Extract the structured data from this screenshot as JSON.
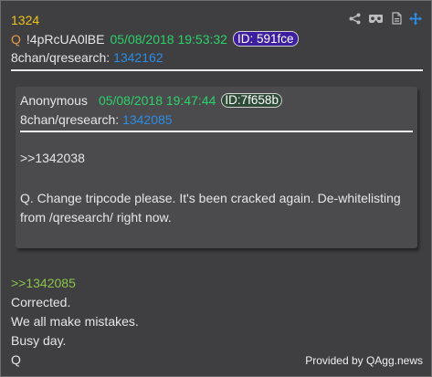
{
  "post": {
    "number": "1324",
    "q_letter": "Q",
    "tripcode": "!4pRcUA0lBE",
    "date": "05/08/2018 19:53:32",
    "id_badge": "ID: 591fce",
    "board_prefix": "8chan/qresearch:",
    "board_post": "1342162"
  },
  "toolbar": {
    "icons": [
      "share-icon",
      "vr-glasses-icon",
      "document-icon",
      "move-arrows-icon"
    ]
  },
  "quoted": {
    "name": "Anonymous",
    "date": "05/08/2018 19:47:44",
    "id_badge": "ID:7f658b",
    "board_prefix": "8chan/qresearch:",
    "board_post": "1342085",
    "ref": ">>1342038",
    "body": "Q. Change tripcode please. It's been cracked again. De-whitelisting from /qresearch/ right now."
  },
  "reply": {
    "ref": ">>1342085",
    "lines": [
      "Corrected.",
      "We all make mistakes.",
      "Busy day.",
      "Q"
    ]
  },
  "footer": {
    "credit": "Provided by QAgg.news"
  },
  "colors": {
    "post_number": "#f0c319",
    "date_green": "#2bd26a",
    "link_blue": "#2c8ce6",
    "reply_ref_green": "#8bc34a",
    "id_badge_purple": "#3d1e9e",
    "background": "#3f3f41"
  }
}
